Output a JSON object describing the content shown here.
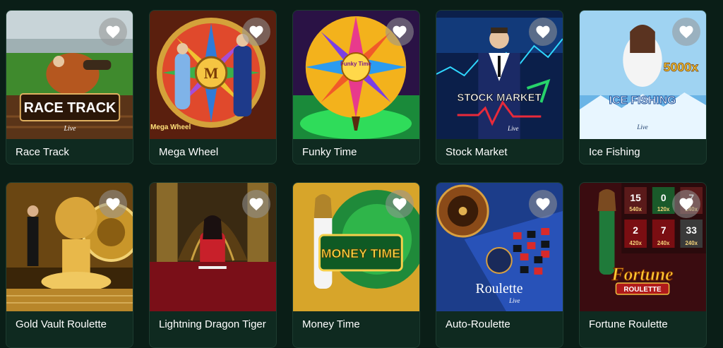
{
  "games": [
    {
      "title": "Race Track",
      "logo_text": "RACE TRACK",
      "provider_badge": "Live"
    },
    {
      "title": "Mega Wheel",
      "logo_text": "Mega Wheel",
      "wheel_center": "M"
    },
    {
      "title": "Funky Time",
      "logo_text": "Funky Time"
    },
    {
      "title": "Stock Market",
      "logo_text": "STOCK MARKET",
      "provider_badge": "Live"
    },
    {
      "title": "Ice Fishing",
      "logo_text": "ICE FISHING",
      "multiplier": "5000x",
      "provider_badge": "Live"
    },
    {
      "title": "Gold Vault Roulette"
    },
    {
      "title": "Lightning Dragon Tiger"
    },
    {
      "title": "Money Time",
      "logo_text": "MONEY TIME"
    },
    {
      "title": "Auto-Roulette",
      "logo_text": "Roulette",
      "provider_badge": "Live"
    },
    {
      "title": "Fortune Roulette",
      "logo_text": "Fortune",
      "logo_sub": "ROULETTE",
      "board_values": [
        "15",
        "0",
        "7",
        "2",
        "7",
        "33"
      ],
      "board_multipliers": [
        "540x",
        "120x",
        "240x",
        "420x",
        "240x",
        "240x"
      ]
    }
  ],
  "colors": {
    "page_bg": "#0a1e17",
    "card_bg": "#0f2a20",
    "text": "#ffffff"
  }
}
